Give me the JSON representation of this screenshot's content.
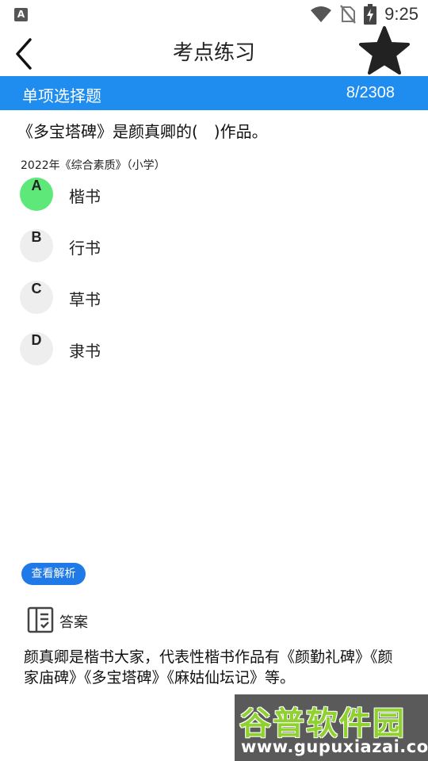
{
  "status_bar": {
    "app_icon_letter": "A",
    "time": "9:25"
  },
  "header": {
    "title": "考点练习"
  },
  "band": {
    "type_label": "单项选择题",
    "progress": "8/2308"
  },
  "question": {
    "text": "《多宝塔碑》是颜真卿的(　)作品。",
    "source": "2022年《综合素质》（小学）"
  },
  "options": [
    {
      "letter": "A",
      "text": "楷书",
      "selected": true
    },
    {
      "letter": "B",
      "text": "行书",
      "selected": false
    },
    {
      "letter": "C",
      "text": "草书",
      "selected": false
    },
    {
      "letter": "D",
      "text": "隶书",
      "selected": false
    }
  ],
  "analysis_button": "查看解析",
  "answer": {
    "label": "答案",
    "text": "颜真卿是楷书大家，代表性楷书作品有《颜勤礼碑》《颜家庙碑》《多宝塔碑》《麻姑仙坛记》等。"
  },
  "watermark": {
    "brand": "谷普软件园",
    "url": "www.gupuxiazai.com"
  },
  "colors": {
    "accent": "#1f8cf0",
    "selected_option": "#5ee87a",
    "option_idle": "#eeeeee"
  },
  "icons": [
    "wifi-icon",
    "no-sim-icon",
    "battery-charging-icon",
    "back-arrow-icon",
    "star-icon",
    "answer-book-icon"
  ]
}
